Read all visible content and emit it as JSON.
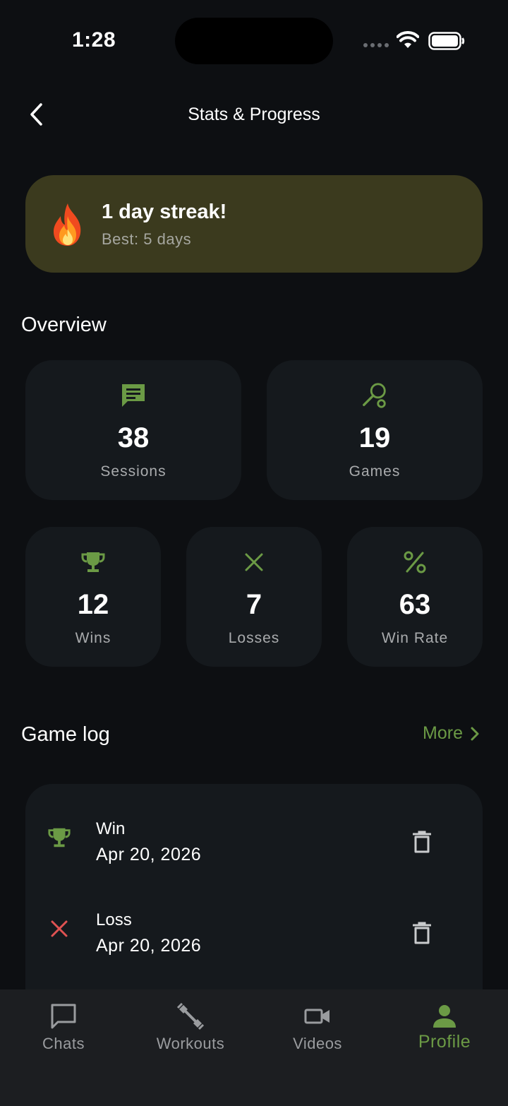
{
  "status_bar": {
    "time": "1:28"
  },
  "header": {
    "title": "Stats & Progress"
  },
  "streak": {
    "title": "1 day streak!",
    "best": "Best: 5 days"
  },
  "overview": {
    "title": "Overview",
    "sessions": {
      "value": "38",
      "label": "Sessions"
    },
    "games": {
      "value": "19",
      "label": "Games"
    },
    "wins": {
      "value": "12",
      "label": "Wins"
    },
    "losses": {
      "value": "7",
      "label": "Losses"
    },
    "win_rate": {
      "value": "63",
      "label": "Win Rate"
    }
  },
  "game_log": {
    "title": "Game log",
    "more_label": "More",
    "entries": [
      {
        "result": "Win",
        "date": "Apr 20, 2026"
      },
      {
        "result": "Loss",
        "date": "Apr 20, 2026"
      }
    ]
  },
  "tabs": [
    {
      "label": "Chats"
    },
    {
      "label": "Workouts"
    },
    {
      "label": "Videos"
    },
    {
      "label": "Profile"
    }
  ],
  "colors": {
    "accent": "#6b9a45",
    "loss": "#e05252",
    "background": "#0d0f12",
    "card": "#15191d",
    "streak_card": "#3b3a1e",
    "tab_bar": "#1c1e21"
  },
  "icons": {
    "back": "chevron-left-icon",
    "streak": "fire-icon",
    "sessions": "chat-bubble-icon",
    "games": "racket-icon",
    "wins": "trophy-icon",
    "losses": "close-icon",
    "win_rate": "percent-icon",
    "more": "chevron-right-icon",
    "delete": "trash-icon"
  }
}
